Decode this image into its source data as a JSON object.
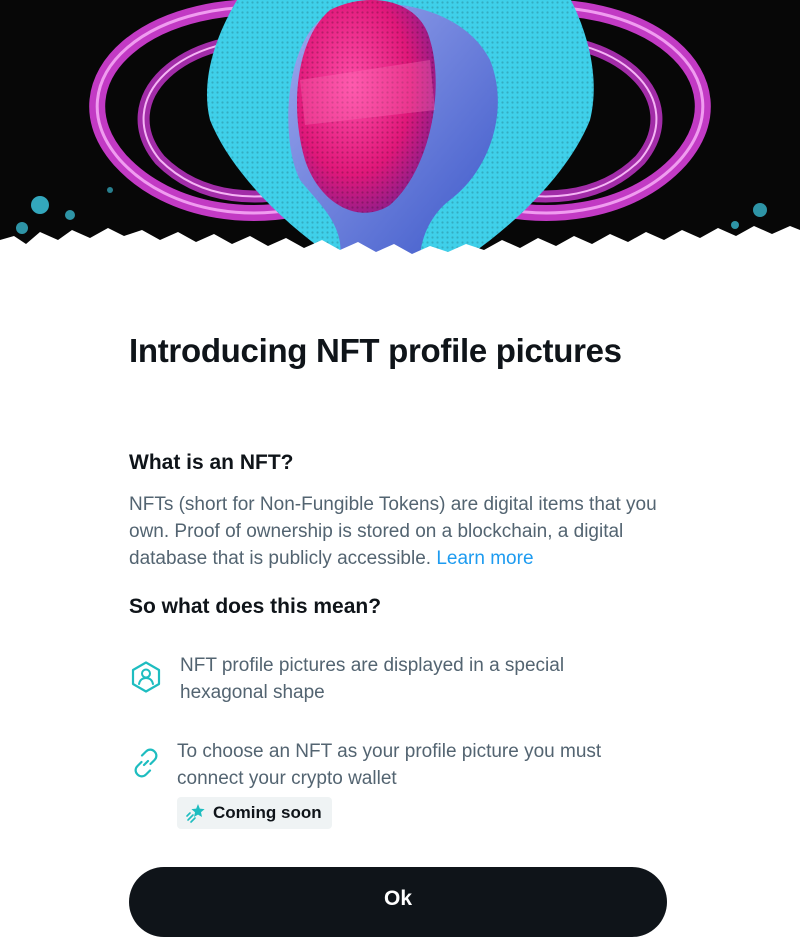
{
  "hero": {
    "image": "nft-hexagon-profile-artwork",
    "colors": {
      "background": "#070707",
      "cyan": "#3fd0ea",
      "magenta": "#e2207a",
      "purple": "#c23ac4"
    }
  },
  "modal": {
    "title": "Introducing NFT profile pictures",
    "section1": {
      "heading": "What is an NFT?",
      "body": "NFTs (short for Non-Fungible Tokens) are digital items that you own. Proof of ownership is stored on a blockchain, a digital database that is publicly accessible.",
      "link_label": "Learn more"
    },
    "section2": {
      "heading": "So what does this mean?",
      "features": [
        {
          "icon": "hexagon-avatar-icon",
          "text": "NFT profile pictures are displayed in a special hexagonal shape"
        },
        {
          "icon": "link-icon",
          "text": "To choose an NFT as your profile picture you must connect your crypto wallet"
        }
      ],
      "badge": {
        "icon": "sparkle-star-icon",
        "label": "Coming soon"
      }
    },
    "ok_label": "Ok",
    "colors": {
      "accent": "#1d9bf0",
      "teal_icon": "#1ebdc0",
      "text_primary": "#0f1419",
      "text_secondary": "#536471",
      "button": "#0f1419"
    }
  }
}
